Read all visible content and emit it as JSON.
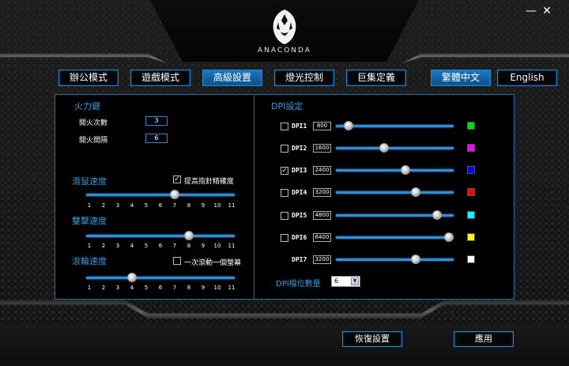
{
  "window": {
    "minimize_glyph": "—",
    "close_glyph": "✕"
  },
  "logo": {
    "text": "ANACONDA"
  },
  "tabs": [
    {
      "label": "辦公模式",
      "active": false
    },
    {
      "label": "遊戲模式",
      "active": false
    },
    {
      "label": "高級設置",
      "active": true
    },
    {
      "label": "燈光控制",
      "active": false
    },
    {
      "label": "巨集定義",
      "active": false
    }
  ],
  "languages": [
    {
      "label": "繁體中文",
      "active": true
    },
    {
      "label": "English",
      "active": false
    }
  ],
  "fire": {
    "title": "火力鍵",
    "count_label": "開火次數",
    "count_value": "3",
    "interval_label": "開火間隔",
    "interval_value": "6"
  },
  "mouse_speed": {
    "title": "滑鼠速度",
    "precision_label": "提高指針精確度",
    "precision_checked": true,
    "value": 7
  },
  "double_click": {
    "title": "雙擊速度",
    "value": 8
  },
  "scroll": {
    "title": "滾輪速度",
    "page_label": "一次滾動一個螢幕",
    "page_checked": false,
    "value": 4
  },
  "ticks": [
    "1",
    "2",
    "3",
    "4",
    "5",
    "6",
    "7",
    "8",
    "9",
    "10",
    "11"
  ],
  "dpi": {
    "title": "DPI設定",
    "rows": [
      {
        "label": "DPI1",
        "value": "800",
        "checked": false,
        "level": 0.11,
        "color": "#00e000"
      },
      {
        "label": "DPI2",
        "value": "1600",
        "checked": false,
        "level": 0.41,
        "color": "#ff00ff"
      },
      {
        "label": "DPI3",
        "value": "2400",
        "checked": true,
        "level": 0.59,
        "color": "#0000ff"
      },
      {
        "label": "DPI4",
        "value": "3200",
        "checked": false,
        "level": 0.68,
        "color": "#ff0000"
      },
      {
        "label": "DPI5",
        "value": "4800",
        "checked": false,
        "level": 0.86,
        "color": "#00ffff"
      },
      {
        "label": "DPI6",
        "value": "6400",
        "checked": false,
        "level": 0.96,
        "color": "#ffff00"
      },
      {
        "label": "DPI7",
        "value": "3200",
        "checked": null,
        "level": 0.68,
        "color": "#ffffff"
      }
    ],
    "levels_label": "DPI檔位數量",
    "levels_value": "6"
  },
  "buttons": {
    "restore": "恢復設置",
    "apply": "應用"
  }
}
